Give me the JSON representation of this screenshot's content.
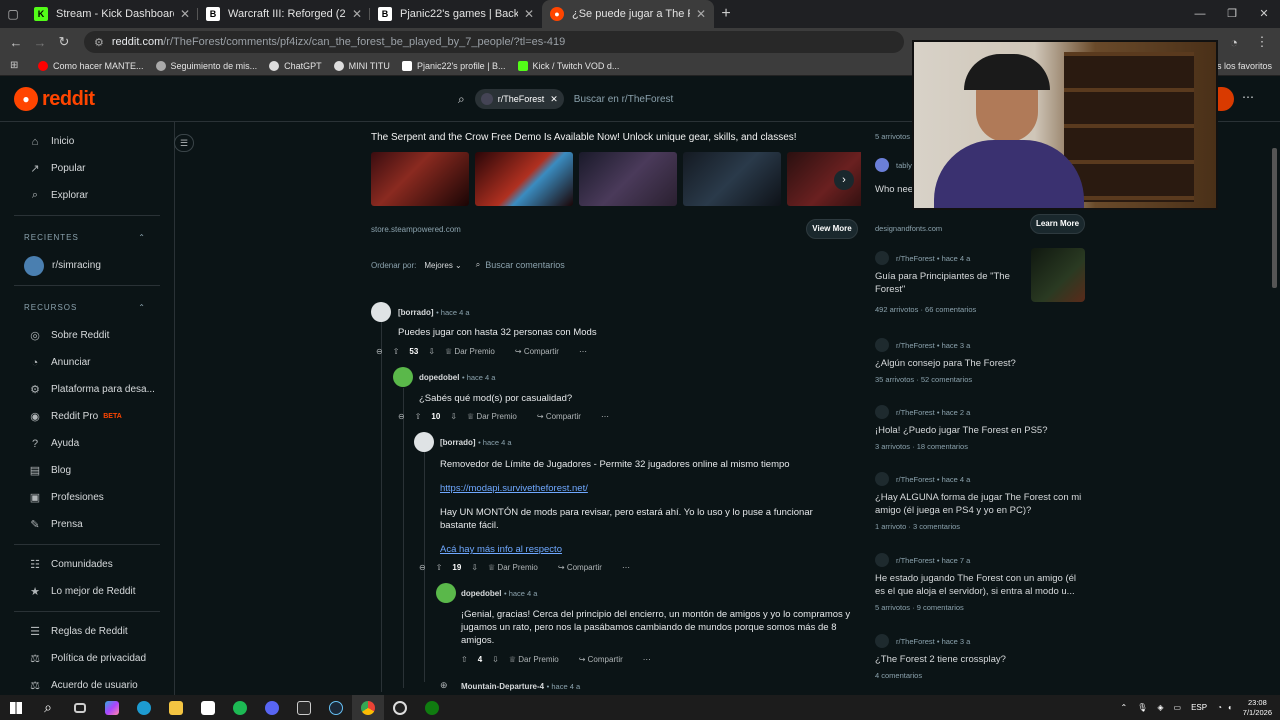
{
  "tabs": [
    {
      "title": "Stream - Kick Dashboard",
      "fav": "K",
      "color": "#53fc18"
    },
    {
      "title": "Warcraft III: Reforged (2020)",
      "fav": "B",
      "color": "#ffffff"
    },
    {
      "title": "Pjanic22's games | Backloggd",
      "fav": "B",
      "color": "#ffffff"
    },
    {
      "title": "¿Se puede jugar a The Forest co",
      "fav": "●",
      "color": "#ff4500"
    }
  ],
  "url": {
    "host": "reddit.com",
    "path": "/r/TheForest/comments/pf4izx/can_the_forest_be_played_by_7_people/?tl=es-419"
  },
  "bookmarks": [
    {
      "label": "Como hacer MANTE...",
      "color": "#ff0000"
    },
    {
      "label": "Seguimiento de mis...",
      "color": "#aaaaaa"
    },
    {
      "label": "ChatGPT",
      "color": "#dddddd"
    },
    {
      "label": "MINI TITU",
      "color": "#dddddd"
    },
    {
      "label": "Pjanic22's profile | B...",
      "color": "#ffffff"
    },
    {
      "label": "Kick / Twitch VOD d...",
      "color": "#53fc18"
    }
  ],
  "bookmarks_right": "dos los favoritos",
  "header": {
    "logo": "reddit",
    "chip": "r/TheForest",
    "placeholder": "Buscar en r/TheForest"
  },
  "sidebar": {
    "nav": [
      {
        "label": "Inicio",
        "icon": "⌂"
      },
      {
        "label": "Popular",
        "icon": "↗"
      },
      {
        "label": "Explorar",
        "icon": "⌕"
      }
    ],
    "recientes_title": "RECIENTES",
    "recientes": [
      {
        "label": "r/simracing"
      }
    ],
    "recursos_title": "RECURSOS",
    "recursos": [
      {
        "label": "Sobre Reddit",
        "icon": "◎"
      },
      {
        "label": "Anunciar",
        "icon": "◔"
      },
      {
        "label": "Plataforma para desa...",
        "icon": "⚙"
      },
      {
        "label": "Reddit Pro",
        "icon": "◉",
        "badge": "BETA"
      },
      {
        "label": "Ayuda",
        "icon": "?"
      },
      {
        "label": "Blog",
        "icon": "▤"
      },
      {
        "label": "Profesiones",
        "icon": "▣"
      },
      {
        "label": "Prensa",
        "icon": "✎"
      }
    ],
    "more": [
      {
        "label": "Comunidades",
        "icon": "☷"
      },
      {
        "label": "Lo mejor de Reddit",
        "icon": "★"
      }
    ],
    "legal": [
      {
        "label": "Reglas de Reddit",
        "icon": "☰"
      },
      {
        "label": "Política de privacidad",
        "icon": "⚖"
      },
      {
        "label": "Acuerdo de usuario",
        "icon": "⚖"
      }
    ]
  },
  "ad": {
    "title": "The Serpent and the Crow Free Demo Is Available Now! Unlock unique gear, skills, and classes!",
    "source": "store.steampowered.com",
    "button": "View More"
  },
  "sort": {
    "label": "Ordenar por:",
    "value": "Mejores",
    "search": "Buscar comentarios"
  },
  "comments": [
    {
      "user": "[borrado]",
      "time": "hace 4 a",
      "text": "Puedes jugar con hasta 32 personas con Mods",
      "score": "53",
      "award": "Dar Premio",
      "share": "Compartir"
    },
    {
      "user": "dopedobel",
      "time": "hace 4 a",
      "text": "¿Sabés qué mod(s) por casualidad?",
      "score": "10",
      "award": "Dar Premio",
      "share": "Compartir"
    },
    {
      "user": "[borrado]",
      "time": "hace 4 a",
      "p1": "Removedor de Límite de Jugadores - Permite 32 jugadores online al mismo tiempo",
      "link1": "https://modapi.survivetheforest.net/",
      "p2": "Hay UN MONTÓN de mods para revisar, pero estará ahí. Yo lo uso y lo puse a funcionar bastante fácil.",
      "link2": "Acá hay más info al respecto",
      "score": "19",
      "award": "Dar Premio",
      "share": "Compartir"
    },
    {
      "user": "dopedobel",
      "time": "hace 4 a",
      "text": "¡Genial, gracias! Cerca del principio del encierro, un montón de amigos y yo lo compramos y jugamos un rato, pero nos la pasábamos cambiando de mundos porque somos más de 8 amigos.",
      "score": "4",
      "award": "Dar Premio",
      "share": "Compartir"
    },
    {
      "user": "Mountain-Departure-4",
      "time": "hace 4 a"
    }
  ],
  "right": {
    "top_meta": "5 arrivotos",
    "ad_user": "tably",
    "ad_title": "Who nee",
    "ad_source": "designandfonts.com",
    "ad_button": "Learn More",
    "posts": [
      {
        "sub": "r/TheForest",
        "time": "hace 4 a",
        "title": "Guía para Principiantes de \"The Forest\"",
        "votes": "492 arrivotos",
        "comments": "66 comentarios"
      },
      {
        "sub": "r/TheForest",
        "time": "hace 3 a",
        "title": "¿Algún consejo para The Forest?",
        "votes": "35 arrivotos",
        "comments": "52 comentarios"
      },
      {
        "sub": "r/TheForest",
        "time": "hace 2 a",
        "title": "¡Hola! ¿Puedo jugar The Forest en PS5?",
        "votes": "3 arrivotos",
        "comments": "18 comentarios"
      },
      {
        "sub": "r/TheForest",
        "time": "hace 4 a",
        "title": "¿Hay ALGUNA forma de jugar The Forest con mi amigo (él juega en PS4 y yo en PC)?",
        "votes": "1 arrivoto",
        "comments": "3 comentarios"
      },
      {
        "sub": "r/TheForest",
        "time": "hace 7 a",
        "title": "He estado jugando The Forest con un amigo (él es el que aloja el servidor), si entra al modo u...",
        "votes": "5 arrivotos",
        "comments": "9 comentarios"
      },
      {
        "sub": "r/TheForest",
        "time": "hace 3 a",
        "title": "¿The Forest 2 tiene crossplay?",
        "votes": "",
        "comments": "4 comentarios"
      }
    ]
  },
  "taskbar": {
    "lang": "ESP",
    "time": "23:08",
    "date": "7/1/2026"
  }
}
